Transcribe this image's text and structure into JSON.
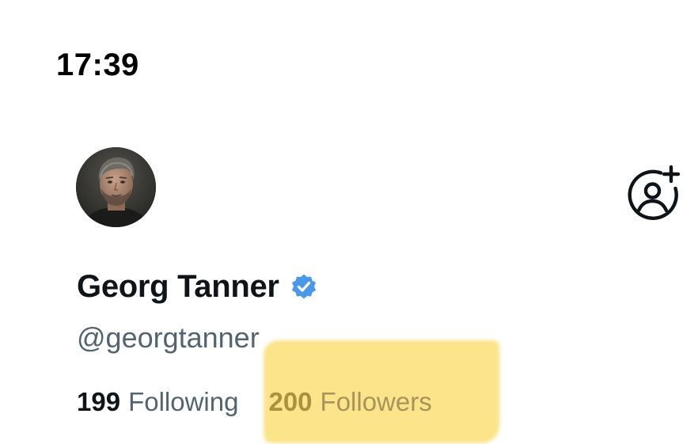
{
  "status_bar": {
    "time": "17:39"
  },
  "profile": {
    "avatar_icon": "user-photo",
    "follow_icon": "person-add-icon",
    "display_name": "Georg Tanner",
    "verified": true,
    "verified_color": "#4a99e9",
    "handle": "@georgtanner",
    "following_count": "199",
    "following_label": "Following",
    "followers_count": "200",
    "followers_label": "Followers",
    "highlight_color": "#fbe27f"
  }
}
